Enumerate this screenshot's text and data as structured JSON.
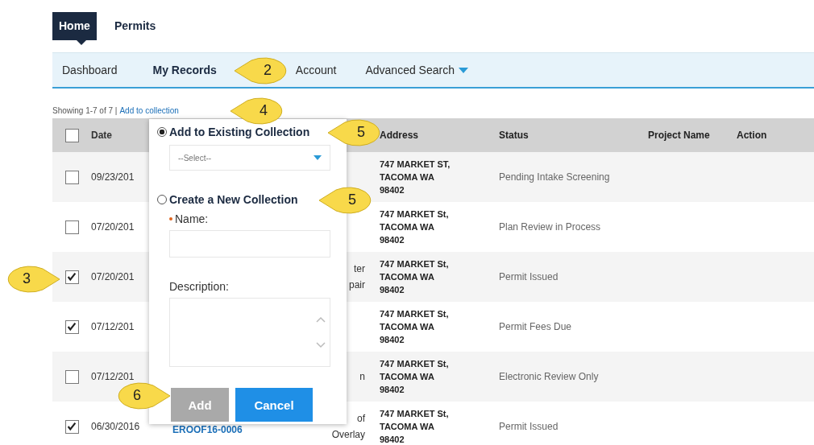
{
  "tabs": [
    {
      "label": "Home",
      "selected": true
    },
    {
      "label": "Permits",
      "selected": false
    }
  ],
  "nav": [
    {
      "label": "Dashboard",
      "selected": false,
      "dropdown": false
    },
    {
      "label": "My Records",
      "selected": true,
      "dropdown": false
    },
    {
      "label": "Account",
      "selected": false,
      "dropdown": false
    },
    {
      "label": "Advanced Search",
      "selected": false,
      "dropdown": true
    }
  ],
  "summary": "Showing 1-7 of 7 |",
  "collection_link": "Add to collection",
  "table": {
    "header_checked": false,
    "columns": [
      "Date",
      "Address",
      "Status",
      "Project Name",
      "Action"
    ],
    "rows": [
      {
        "checked": false,
        "date": "09/23/201",
        "address": [
          "747 MARKET ST,",
          "TACOMA WA",
          "98402"
        ],
        "status": "Pending Intake Screening"
      },
      {
        "checked": false,
        "date": "07/20/201",
        "address": [
          "747 MARKET St,",
          "TACOMA WA",
          "98402"
        ],
        "status": "Plan Review in Process"
      },
      {
        "checked": true,
        "date": "07/20/201",
        "column_3": [
          "ter",
          "pair"
        ],
        "address": [
          "747 MARKET St,",
          "TACOMA WA",
          "98402"
        ],
        "status": "Permit Issued"
      },
      {
        "checked": true,
        "date": "07/12/201",
        "address": [
          "747 MARKET St,",
          "TACOMA WA",
          "98402"
        ],
        "status": "Permit Fees Due"
      },
      {
        "checked": false,
        "date": "07/12/201",
        "column_3": [
          "n"
        ],
        "address": [
          "747 MARKET St,",
          "TACOMA WA",
          "98402"
        ],
        "status": "Electronic Review Only"
      },
      {
        "checked": true,
        "date": "06/30/2016",
        "record": "EROOF16-0006",
        "column_3": [
          "of",
          "Overlay"
        ],
        "address": [
          "747 MARKET St,",
          "TACOMA WA",
          "98402"
        ],
        "status": "Permit Issued"
      }
    ]
  },
  "popup": {
    "options": [
      {
        "label": "Add to Existing Collection",
        "selected": true
      },
      {
        "label": "Create a New Collection",
        "selected": false
      }
    ],
    "select_placeholder": "--Select--",
    "name_label": "Name:",
    "name_required": true,
    "description_label": "Description:",
    "buttons": [
      {
        "label": "Add",
        "disabled": true
      },
      {
        "label": "Cancel",
        "disabled": false
      }
    ]
  },
  "callouts": [
    {
      "label": "2"
    },
    {
      "label": "4"
    },
    {
      "label": "5"
    },
    {
      "label": "5"
    },
    {
      "label": "3"
    },
    {
      "label": "6"
    }
  ]
}
